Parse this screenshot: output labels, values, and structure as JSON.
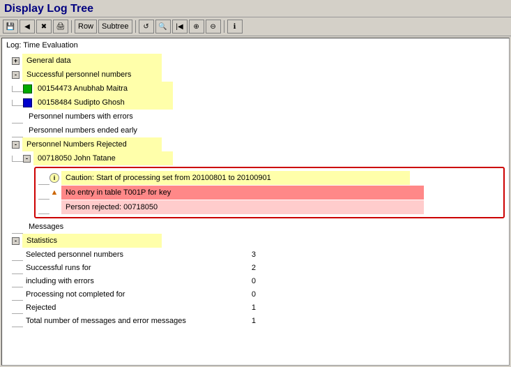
{
  "title": "Display Log Tree",
  "toolbar": {
    "buttons": [
      {
        "name": "save-btn",
        "icon": "💾",
        "label": "Save"
      },
      {
        "name": "back-btn",
        "icon": "◀",
        "label": "Back"
      },
      {
        "name": "exit-btn",
        "icon": "✖",
        "label": "Exit"
      },
      {
        "name": "print-btn",
        "icon": "🖨",
        "label": "Print"
      },
      {
        "name": "row-label",
        "text": "Row"
      },
      {
        "name": "subtree-label",
        "text": "Subtree"
      },
      {
        "name": "refresh-btn",
        "icon": "↺",
        "label": "Refresh"
      },
      {
        "name": "search-btn",
        "icon": "🔍",
        "label": "Search"
      },
      {
        "name": "first-btn",
        "icon": "⊳|",
        "label": "First"
      },
      {
        "name": "expand-btn",
        "icon": "⊕",
        "label": "Expand"
      },
      {
        "name": "collapse-btn",
        "icon": "⊖",
        "label": "Collapse"
      },
      {
        "name": "info-btn",
        "icon": "ℹ",
        "label": "Info"
      }
    ]
  },
  "log_title": "Log: Time Evaluation",
  "tree": {
    "nodes": [
      {
        "id": "general-data",
        "indent": 0,
        "expandable": true,
        "label": "General data",
        "style": "yellow"
      },
      {
        "id": "successful-personnel",
        "indent": 0,
        "expandable": true,
        "label": "Successful personnel numbers",
        "style": "yellow"
      },
      {
        "id": "person1",
        "indent": 1,
        "expandable": false,
        "icon": "green",
        "label": "00154473 Anubhab Maitra",
        "style": "yellow"
      },
      {
        "id": "person2",
        "indent": 1,
        "expandable": false,
        "icon": "blue",
        "label": "00158484 Sudipto Ghosh",
        "style": "yellow"
      },
      {
        "id": "errors",
        "indent": 0,
        "expandable": false,
        "label": "Personnel numbers with errors",
        "style": "plain"
      },
      {
        "id": "ended-early",
        "indent": 0,
        "expandable": false,
        "label": "Personnel numbers ended early",
        "style": "plain"
      },
      {
        "id": "rejected",
        "indent": 0,
        "expandable": true,
        "label": "Personnel Numbers Rejected",
        "style": "yellow"
      },
      {
        "id": "rejected-person",
        "indent": 1,
        "expandable": true,
        "label": "00718050 John Tatane",
        "style": "yellow"
      },
      {
        "id": "messages",
        "indent": 0,
        "expandable": false,
        "label": "Messages",
        "style": "plain"
      },
      {
        "id": "statistics",
        "indent": 0,
        "expandable": true,
        "label": "Statistics",
        "style": "yellow"
      }
    ],
    "error_box": {
      "caution": "Caution: Start of processing set from 20100801 to 20100901",
      "error": "No entry in table T001P for key",
      "rejected": "Person rejected: 00718050"
    },
    "stats": [
      {
        "label": "Selected personnel numbers",
        "value": "3"
      },
      {
        "label": "Successful runs for",
        "value": "2"
      },
      {
        "label": "including with errors",
        "value": "0"
      },
      {
        "label": "Processing not completed for",
        "value": "0"
      },
      {
        "label": "Rejected",
        "value": "1"
      },
      {
        "label": "Total number of messages and error messages",
        "value": "1"
      }
    ]
  }
}
